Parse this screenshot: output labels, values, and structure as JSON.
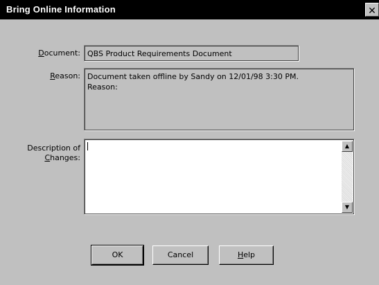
{
  "window": {
    "title": "Bring Online Information",
    "close_glyph": "✕"
  },
  "document": {
    "label_accel": "D",
    "label_rest": "ocument:",
    "value": "QBS Product Requirements Document"
  },
  "reason": {
    "label_accel": "R",
    "label_rest": "eason:",
    "value": "Document taken offline by Sandy on 12/01/98 3:30 PM.\nReason:"
  },
  "description": {
    "label_line1": "Description of",
    "label_accel": "C",
    "label_rest": "hanges:",
    "value": ""
  },
  "scrollbar": {
    "up_glyph": "▲",
    "down_glyph": "▼"
  },
  "buttons": {
    "ok": "OK",
    "cancel": "Cancel",
    "help_accel": "H",
    "help_rest": "elp"
  },
  "colors": {
    "dialog_bg": "#c0c0c0",
    "titlebar_bg": "#000000",
    "title_text": "#ffffff"
  }
}
